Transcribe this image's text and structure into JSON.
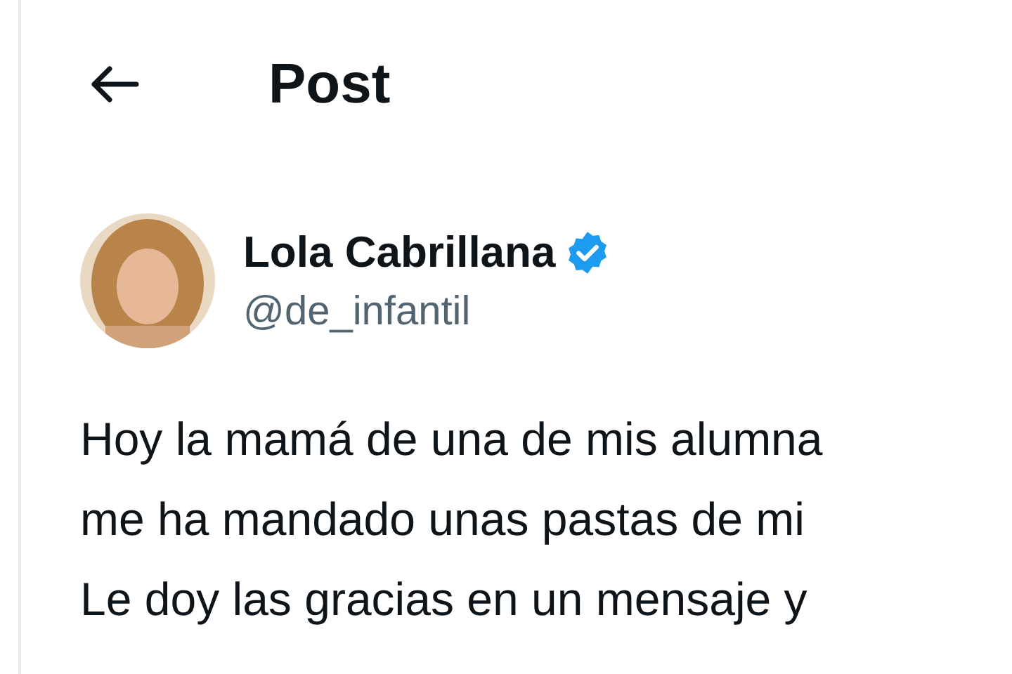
{
  "header": {
    "title": "Post"
  },
  "author": {
    "name": "Lola Cabrillana",
    "verified": true,
    "handle": "@de_infantil"
  },
  "post": {
    "text_lines": [
      "Hoy la mamá de una de mis alumna",
      "me ha mandado unas pastas de mi",
      "Le doy las gracias en un mensaje y"
    ]
  }
}
